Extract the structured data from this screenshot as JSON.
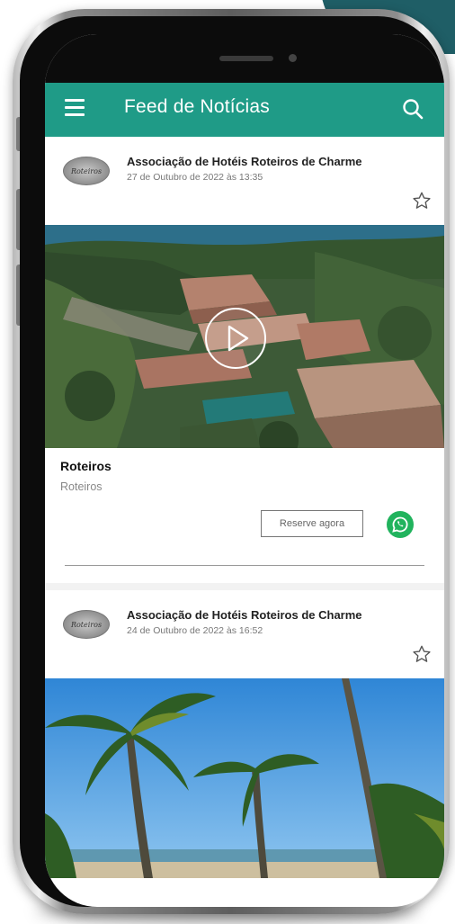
{
  "app": {
    "title": "Feed de Notícias",
    "accent_color": "#1f9b87"
  },
  "icons": {
    "menu": "hamburger-menu-icon",
    "search": "search-icon",
    "favorite": "star-outline-icon",
    "play": "play-icon",
    "whatsapp": "whatsapp-icon"
  },
  "posts": [
    {
      "author": "Associação de Hotéis Roteiros de Charme",
      "date": "27 de Outubro de 2022 às 13:35",
      "media_type": "video",
      "title": "Roteiros",
      "text": "Roteiros",
      "cta_label": "Reserve agora"
    },
    {
      "author": "Associação de Hotéis Roteiros de Charme",
      "date": "24 de Outubro de 2022 às 16:52",
      "media_type": "image"
    }
  ]
}
